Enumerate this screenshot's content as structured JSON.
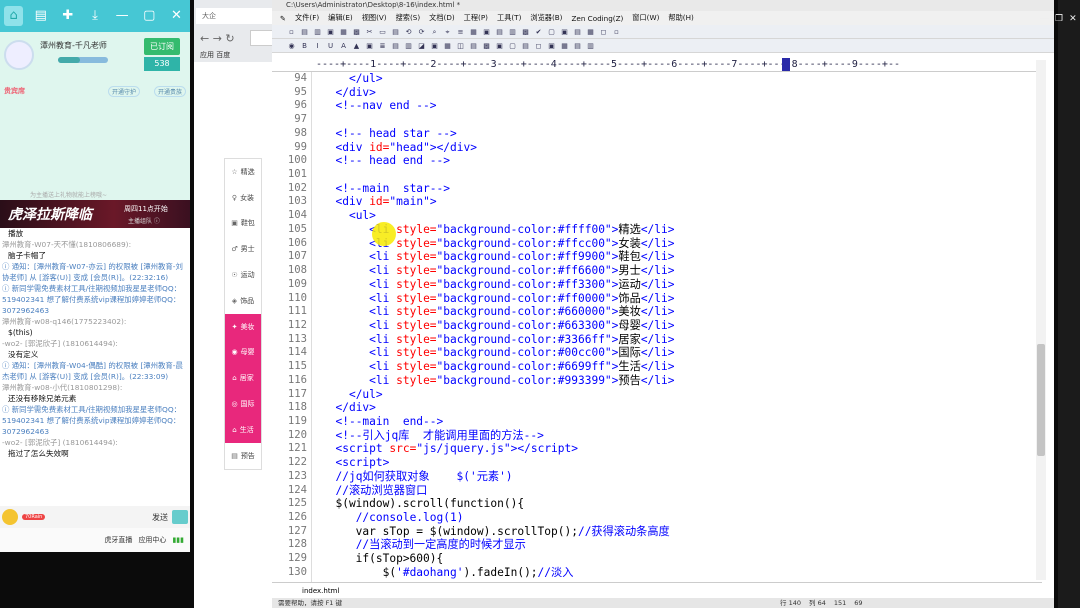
{
  "chat": {
    "nick": "潭州教育-千凡老师",
    "follow_btn": "已订阅",
    "follow_count": "538",
    "vip_text": "贵宾席",
    "open_guard": "开通守护",
    "open_vip": "开通贵族",
    "notice_hint": "为主播送上礼物就能上榜哦~",
    "banner_text": "虎泽拉斯降临",
    "banner_time": "周四11点开始",
    "banner_sub": "主播组队 ⓘ",
    "messages": [
      {
        "type": "body",
        "text": "播放"
      },
      {
        "type": "user",
        "text": "潭州教育-W07-天不懂(1810806689):"
      },
      {
        "type": "body",
        "text": "脑子卡帽了"
      },
      {
        "type": "sys",
        "text": "ⓘ 通知：[潭州教育-W07-亦云] 的权限被 [潭州教育-刘协老师] 从 [游客(U)] 变成 [会员(R)]。(22:32:16)"
      },
      {
        "type": "sys",
        "text": "ⓘ 新同学需免费素材工具/往期视频加我星星老师QQ：519402341  想了解付费系统vip课程加婷婷老师QQ：3072962463"
      },
      {
        "type": "user",
        "text": "潭州教育-w08-q146(1775223402):"
      },
      {
        "type": "body",
        "text": "$(this)"
      },
      {
        "type": "user",
        "text": "-wo2- [郭泥欣子] (1810614494):"
      },
      {
        "type": "body",
        "text": "没有定义"
      },
      {
        "type": "sys",
        "text": "ⓘ 通知：[潭州教育-W04-偶酷] 的权限被 [潭州教育-晨杰老师] 从 [游客(U)] 变成 [会员(R)]。(22:33:09)"
      },
      {
        "type": "user",
        "text": "潭州教育-w08-小代(1810801298):"
      },
      {
        "type": "body",
        "text": "还没有移除兄弟元素"
      },
      {
        "type": "sys",
        "text": "ⓘ 新同学需免费素材工具/往期视频加我星星老师QQ：519402341  想了解付费系统vip课程加婷婷老师QQ：3072962463"
      },
      {
        "type": "user",
        "text": "-wo2- [郭泥欣子] (1810614494):"
      },
      {
        "type": "body",
        "text": "拖过了怎么失效啊"
      }
    ],
    "input_badge": "70Rain",
    "send_label": "发送",
    "footer_live": "虎牙直播",
    "footer_app": "应用中心"
  },
  "browser": {
    "tab_label": "大企",
    "bookmark_apps": "应用",
    "bookmark_page": "百度"
  },
  "sidebar_menu": [
    {
      "icon": "☆",
      "label": "精选",
      "pink": false
    },
    {
      "icon": "♀",
      "label": "女装",
      "pink": false
    },
    {
      "icon": "▣",
      "label": "鞋包",
      "pink": false
    },
    {
      "icon": "♂",
      "label": "男士",
      "pink": false
    },
    {
      "icon": "☉",
      "label": "运动",
      "pink": false
    },
    {
      "icon": "◈",
      "label": "饰品",
      "pink": false
    },
    {
      "icon": "✦",
      "label": "美妆",
      "pink": true
    },
    {
      "icon": "◉",
      "label": "母婴",
      "pink": true
    },
    {
      "icon": "⌂",
      "label": "居家",
      "pink": true
    },
    {
      "icon": "◎",
      "label": "国际",
      "pink": true
    },
    {
      "icon": "⌂",
      "label": "生活",
      "pink": true
    },
    {
      "icon": "▤",
      "label": "预告",
      "pink": false
    }
  ],
  "editor": {
    "title": "C:\\Users\\Administrator\\Desktop\\8-16\\index.html *",
    "menu": [
      "文件(F)",
      "编辑(E)",
      "视图(V)",
      "搜索(S)",
      "文档(D)",
      "工程(P)",
      "工具(T)",
      "浏览器(B)",
      "Zen Coding(Z)",
      "窗口(W)",
      "帮助(H)"
    ],
    "ruler": "----+----1----+----2----+----3----+----4----+----5----+----6----+----7----+----8----+----9----+--",
    "doc_tab": "index.html",
    "status": [
      "需要帮助，请按 F1 键",
      "行 140",
      "列 64",
      "151",
      "69"
    ],
    "lines": [
      {
        "n": "94",
        "html": "    <span class=\"tag\">&lt;/ul&gt;</span>"
      },
      {
        "n": "95",
        "html": "  <span class=\"tag\">&lt;/div&gt;</span>"
      },
      {
        "n": "96",
        "html": "  <span class=\"cmt\">&lt;!--nav end --&gt;</span>"
      },
      {
        "n": "97",
        "html": ""
      },
      {
        "n": "98",
        "html": "  <span class=\"cmt\">&lt;!-- head star --&gt;</span>"
      },
      {
        "n": "99",
        "html": "  <span class=\"tag\">&lt;div</span> <span class=\"attr\">id=</span><span class=\"str\">\"head\"</span><span class=\"tag\">&gt;&lt;/div&gt;</span>"
      },
      {
        "n": "100",
        "html": "  <span class=\"cmt\">&lt;!-- head end --&gt;</span>"
      },
      {
        "n": "101",
        "html": ""
      },
      {
        "n": "102",
        "html": "  <span class=\"cmt\">&lt;!--main  star--&gt;</span>"
      },
      {
        "n": "103",
        "html": "  <span class=\"tag\">&lt;div</span> <span class=\"attr\">id=</span><span class=\"str\">\"main\"</span><span class=\"tag\">&gt;</span>"
      },
      {
        "n": "104",
        "html": "    <span class=\"tag\">&lt;ul&gt;</span>"
      },
      {
        "n": "105",
        "html": "       <span class=\"tag\">&lt;li</span> <span class=\"attr\">style=</span><span class=\"str\">\"background-color:#ffff00\"</span><span class=\"tag\">&gt;</span>精选<span class=\"tag\">&lt;/li&gt;</span>"
      },
      {
        "n": "106",
        "html": "       <span class=\"tag\">&lt;li</span> <span class=\"attr\">style=</span><span class=\"str\">\"background-color:#ffcc00\"</span><span class=\"tag\">&gt;</span>女装<span class=\"tag\">&lt;/li&gt;</span>"
      },
      {
        "n": "107",
        "html": "       <span class=\"tag\">&lt;li</span> <span class=\"attr\">style=</span><span class=\"str\">\"background-color:#ff9900\"</span><span class=\"tag\">&gt;</span>鞋包<span class=\"tag\">&lt;/li&gt;</span>"
      },
      {
        "n": "108",
        "html": "       <span class=\"tag\">&lt;li</span> <span class=\"attr\">style=</span><span class=\"str\">\"background-color:#ff6600\"</span><span class=\"tag\">&gt;</span>男士<span class=\"tag\">&lt;/li&gt;</span>"
      },
      {
        "n": "109",
        "html": "       <span class=\"tag\">&lt;li</span> <span class=\"attr\">style=</span><span class=\"str\">\"background-color:#ff3300\"</span><span class=\"tag\">&gt;</span>运动<span class=\"tag\">&lt;/li&gt;</span>"
      },
      {
        "n": "110",
        "html": "       <span class=\"tag\">&lt;li</span> <span class=\"attr\">style=</span><span class=\"str\">\"background-color:#ff0000\"</span><span class=\"tag\">&gt;</span>饰品<span class=\"tag\">&lt;/li&gt;</span>"
      },
      {
        "n": "111",
        "html": "       <span class=\"tag\">&lt;li</span> <span class=\"attr\">style=</span><span class=\"str\">\"background-color:#660000\"</span><span class=\"tag\">&gt;</span>美妆<span class=\"tag\">&lt;/li&gt;</span>"
      },
      {
        "n": "112",
        "html": "       <span class=\"tag\">&lt;li</span> <span class=\"attr\">style=</span><span class=\"str\">\"background-color:#663300\"</span><span class=\"tag\">&gt;</span>母婴<span class=\"tag\">&lt;/li&gt;</span>"
      },
      {
        "n": "113",
        "html": "       <span class=\"tag\">&lt;li</span> <span class=\"attr\">style=</span><span class=\"str\">\"background-color:#3366ff\"</span><span class=\"tag\">&gt;</span>居家<span class=\"tag\">&lt;/li&gt;</span>"
      },
      {
        "n": "114",
        "html": "       <span class=\"tag\">&lt;li</span> <span class=\"attr\">style=</span><span class=\"str\">\"background-color:#00cc00\"</span><span class=\"tag\">&gt;</span>国际<span class=\"tag\">&lt;/li&gt;</span>"
      },
      {
        "n": "115",
        "html": "       <span class=\"tag\">&lt;li</span> <span class=\"attr\">style=</span><span class=\"str\">\"background-color:#6699ff\"</span><span class=\"tag\">&gt;</span>生活<span class=\"tag\">&lt;/li&gt;</span>"
      },
      {
        "n": "116",
        "html": "       <span class=\"tag\">&lt;li</span> <span class=\"attr\">style=</span><span class=\"str\">\"background-color:#993399\"</span><span class=\"tag\">&gt;</span>预告<span class=\"tag\">&lt;/li&gt;</span>"
      },
      {
        "n": "117",
        "html": "    <span class=\"tag\">&lt;/ul&gt;</span>"
      },
      {
        "n": "118",
        "html": "  <span class=\"tag\">&lt;/div&gt;</span>"
      },
      {
        "n": "119",
        "html": "  <span class=\"cmt\">&lt;!--main  end--&gt;</span>"
      },
      {
        "n": "120",
        "html": "  <span class=\"cmt\">&lt;!--引入jq库  才能调用里面的方法--&gt;</span>"
      },
      {
        "n": "121",
        "html": "  <span class=\"tag\">&lt;script</span> <span class=\"attr\">src=</span><span class=\"str\">\"js/jquery.js\"</span><span class=\"tag\">&gt;&lt;/script&gt;</span>"
      },
      {
        "n": "122",
        "html": "  <span class=\"tag\">&lt;script&gt;</span>"
      },
      {
        "n": "123",
        "html": "  <span class=\"cmt\">//jq如何获取对象    $('元素')</span>"
      },
      {
        "n": "124",
        "html": "  <span class=\"cmt\">//滚动浏览器窗口</span>"
      },
      {
        "n": "125",
        "html": "  $(window).scroll(function(){"
      },
      {
        "n": "126",
        "html": "     <span class=\"cmt\">//console.log(1)</span>"
      },
      {
        "n": "127",
        "html": "     var sTop = $(window).scrollTop();<span class=\"cmt\">//获得滚动条高度</span>"
      },
      {
        "n": "128",
        "html": "     <span class=\"cmt\">//当滚动到一定高度的时候才显示</span>"
      },
      {
        "n": "129",
        "html": "     if(sTop&gt;600){"
      },
      {
        "n": "130",
        "html": "         $(<span class=\"str\">'#daohang'</span>).fadeIn();<span class=\"cmt\">//淡入</span>"
      }
    ]
  }
}
